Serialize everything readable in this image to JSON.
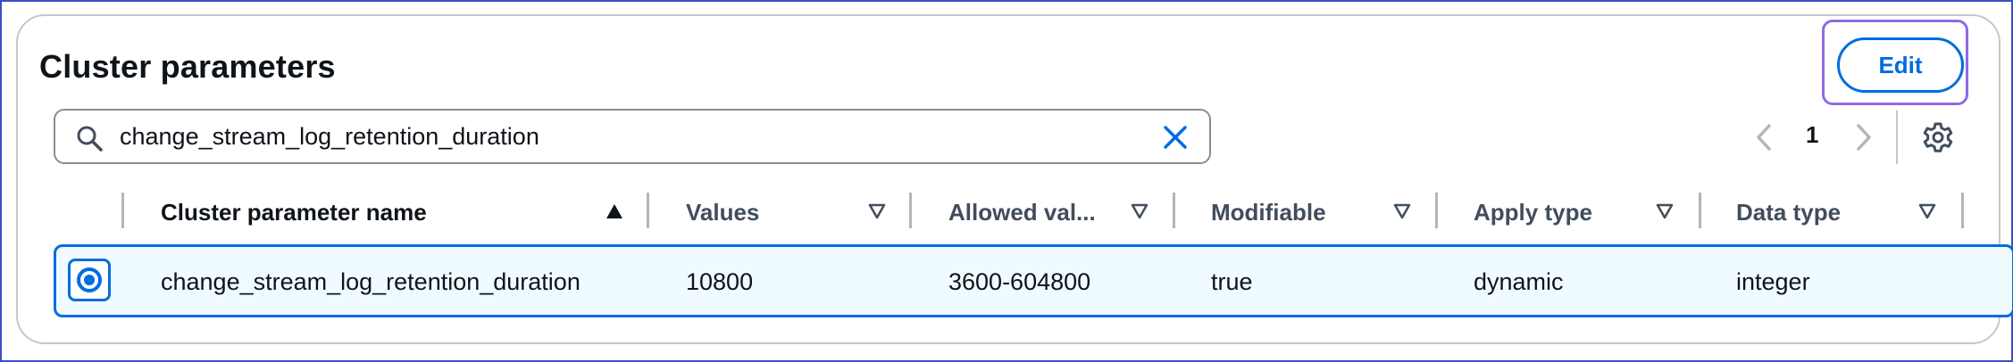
{
  "header": {
    "title": "Cluster parameters",
    "edit_label": "Edit"
  },
  "search": {
    "value": "change_stream_log_retention_duration"
  },
  "pagination": {
    "current_page": "1"
  },
  "table": {
    "columns": [
      {
        "label": "Cluster parameter name",
        "sort": "ascending"
      },
      {
        "label": "Values",
        "sort": "none"
      },
      {
        "label": "Allowed val...",
        "sort": "none"
      },
      {
        "label": "Modifiable",
        "sort": "none"
      },
      {
        "label": "Apply type",
        "sort": "none"
      },
      {
        "label": "Data type",
        "sort": "none"
      }
    ],
    "rows": [
      {
        "selected": true,
        "cells": [
          "change_stream_log_retention_duration",
          "10800",
          "3600-604800",
          "true",
          "dynamic",
          "integer"
        ]
      }
    ]
  },
  "icons": {
    "search": "search-icon",
    "clear": "close-icon",
    "prev": "chevron-left-icon",
    "next": "chevron-right-icon",
    "settings": "gear-icon",
    "sort_asc": "caret-up-filled-icon",
    "sort_none": "caret-down-outline-icon"
  },
  "colors": {
    "accent": "#006ce0",
    "focus_ring": "#8f6ae6",
    "selected_row_bg": "#f0fbff",
    "border": "#c6c6cd"
  }
}
